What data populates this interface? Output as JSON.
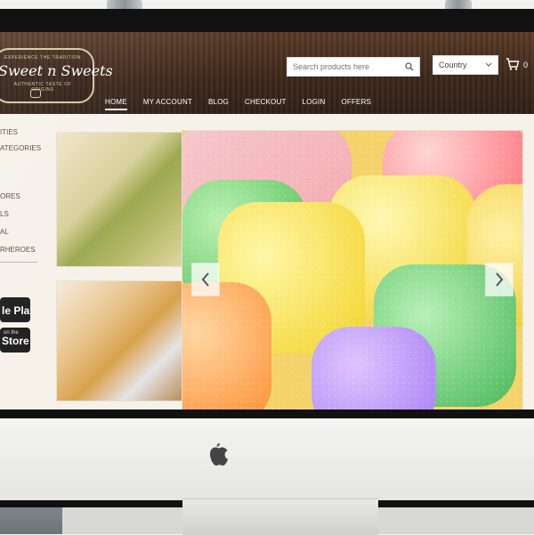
{
  "logo": {
    "top": "EXPERIENCE THE TRADITION",
    "name": "Sweet n Sweets",
    "sub": "AUTHENTIC TASTE OF ORIGINS"
  },
  "search": {
    "placeholder": "Search products here",
    "value": ""
  },
  "country": {
    "selected": "Country"
  },
  "cart": {
    "count": "0"
  },
  "nav": {
    "items": [
      {
        "label": "HOME"
      },
      {
        "label": "MY ACCOUNT"
      },
      {
        "label": "BLOG"
      },
      {
        "label": "CHECKOUT"
      },
      {
        "label": "LOGIN"
      },
      {
        "label": "OFFERS"
      }
    ]
  },
  "sidebar": {
    "items": [
      {
        "label": "ITIES"
      },
      {
        "label": "ATEGORIES"
      },
      {
        "label": "ORES"
      },
      {
        "label": "LS"
      },
      {
        "label": "AL"
      },
      {
        "label": "RHEROES"
      }
    ],
    "stores": [
      {
        "small": "",
        "big": "le Play"
      },
      {
        "small": "on the",
        "big": "Store"
      }
    ]
  }
}
